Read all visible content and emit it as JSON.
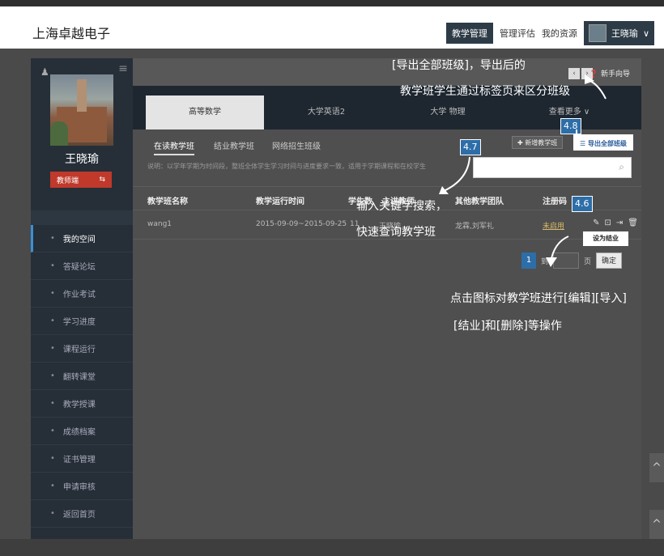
{
  "header": {
    "brand": "上海卓越电子",
    "nav": [
      {
        "label": "教学管理",
        "active": true
      },
      {
        "label": "管理评估",
        "active": false
      },
      {
        "label": "我的资源",
        "active": false
      }
    ],
    "user_name": "王晓瑜"
  },
  "sidebar": {
    "name": "王晓瑜",
    "role": "教师端",
    "items": [
      {
        "label": "我的空间",
        "active": true
      },
      {
        "label": "答疑论坛"
      },
      {
        "label": "作业考试"
      },
      {
        "label": "学习进度"
      },
      {
        "label": "课程运行"
      },
      {
        "label": "翻转课堂"
      },
      {
        "label": "教学授课"
      },
      {
        "label": "成绩档案"
      },
      {
        "label": "证书管理"
      },
      {
        "label": "申请审核"
      },
      {
        "label": "返回首页"
      }
    ]
  },
  "main": {
    "guide": "新手向导",
    "course_tabs": [
      "高等数学",
      "大学英语2",
      "大学 物理",
      "查看更多"
    ],
    "sub_tabs": [
      "在读教学班",
      "结业教学班",
      "网络招生班级"
    ],
    "new_class_btn": "新增教学班",
    "export_btn": "导出全部班级",
    "note": "说明：以学年学期为时间段，整班全体学生学习时间与进度要求一致，适用于学期课程和在校学生",
    "search": {
      "placeholder": ""
    },
    "table": {
      "headers": [
        "教学班名称",
        "教学运行时间",
        "学生数",
        "主讲教师",
        "其他教学团队",
        "注册码"
      ],
      "rows": [
        {
          "name": "wang1",
          "period": "2015-09-09~2015-09-25",
          "students": "11",
          "teacher": "王晓瑜",
          "team": "龙霖,刘军礼",
          "code": "未启用"
        }
      ]
    },
    "finish_tip": "设为结业",
    "pager": {
      "current": "1",
      "to": "到",
      "page": "页",
      "ok": "确定"
    }
  },
  "annotations": {
    "a48_text1": "[导出全部班级]，导出后的",
    "a48_text2": "教学班学生通过标签页来区分班级",
    "a48_badge": "4.8",
    "a47_badge": "4.7",
    "a47_text1": "输入关键字搜索，",
    "a47_text2": "快速查询教学班",
    "a46_badge": "4.6",
    "a46_text1": "点击图标对教学班进行[编辑][导入]",
    "a46_text2": "[结业]和[删除]等操作"
  }
}
